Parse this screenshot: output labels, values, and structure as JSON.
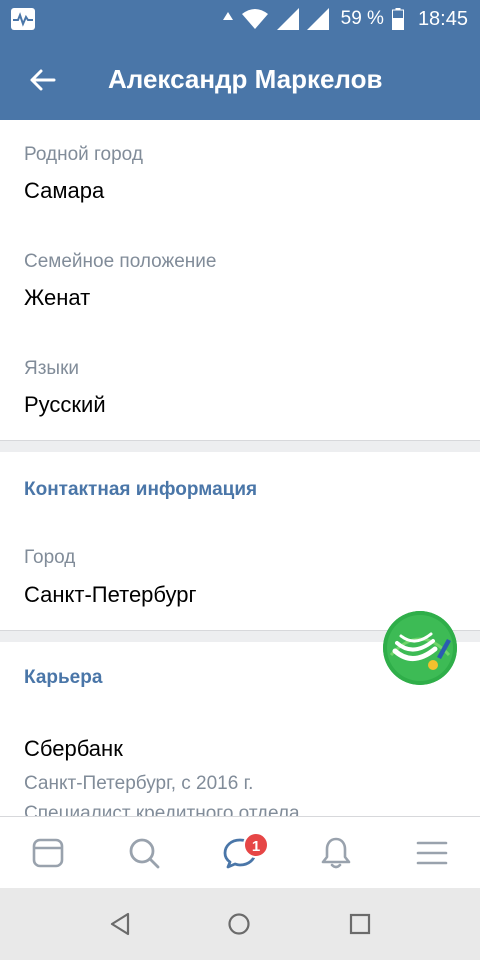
{
  "status_bar": {
    "battery_percent": "59 %",
    "time": "18:45",
    "icons": [
      "activity-icon",
      "data-arrow-icon",
      "wifi-icon",
      "signal-icon",
      "signal-icon",
      "battery-icon"
    ]
  },
  "header": {
    "title": "Александр Маркелов",
    "back_icon": "arrow-left-icon",
    "background": "#4a76a8"
  },
  "basic_info": [
    {
      "label": "Родной город",
      "value": "Самара"
    },
    {
      "label": "Семейное положение",
      "value": "Женат"
    },
    {
      "label": "Языки",
      "value": "Русский"
    }
  ],
  "contacts": {
    "title": "Контактная информация",
    "items": [
      {
        "label": "Город",
        "value": "Санкт-Петербург"
      }
    ]
  },
  "career": {
    "title": "Карьера",
    "company": "Сбербанк",
    "details": "Санкт-Петербург, с 2016 г.",
    "position": "Специалист кредитного отдела",
    "logo_icon": "sberbank-logo-icon"
  },
  "tab_bar": {
    "tabs": [
      {
        "name": "news",
        "icon": "newsfeed-icon"
      },
      {
        "name": "search",
        "icon": "search-icon"
      },
      {
        "name": "messages",
        "icon": "messages-icon",
        "badge": "1"
      },
      {
        "name": "notifications",
        "icon": "bell-icon"
      },
      {
        "name": "menu",
        "icon": "menu-icon"
      }
    ],
    "badge_color": "#e64646"
  },
  "nav_bar": {
    "buttons": [
      "back-triangle-icon",
      "home-circle-icon",
      "recents-square-icon"
    ]
  },
  "colors": {
    "accent": "#4a76a8",
    "label": "#818c99",
    "background": "#edeef0"
  }
}
